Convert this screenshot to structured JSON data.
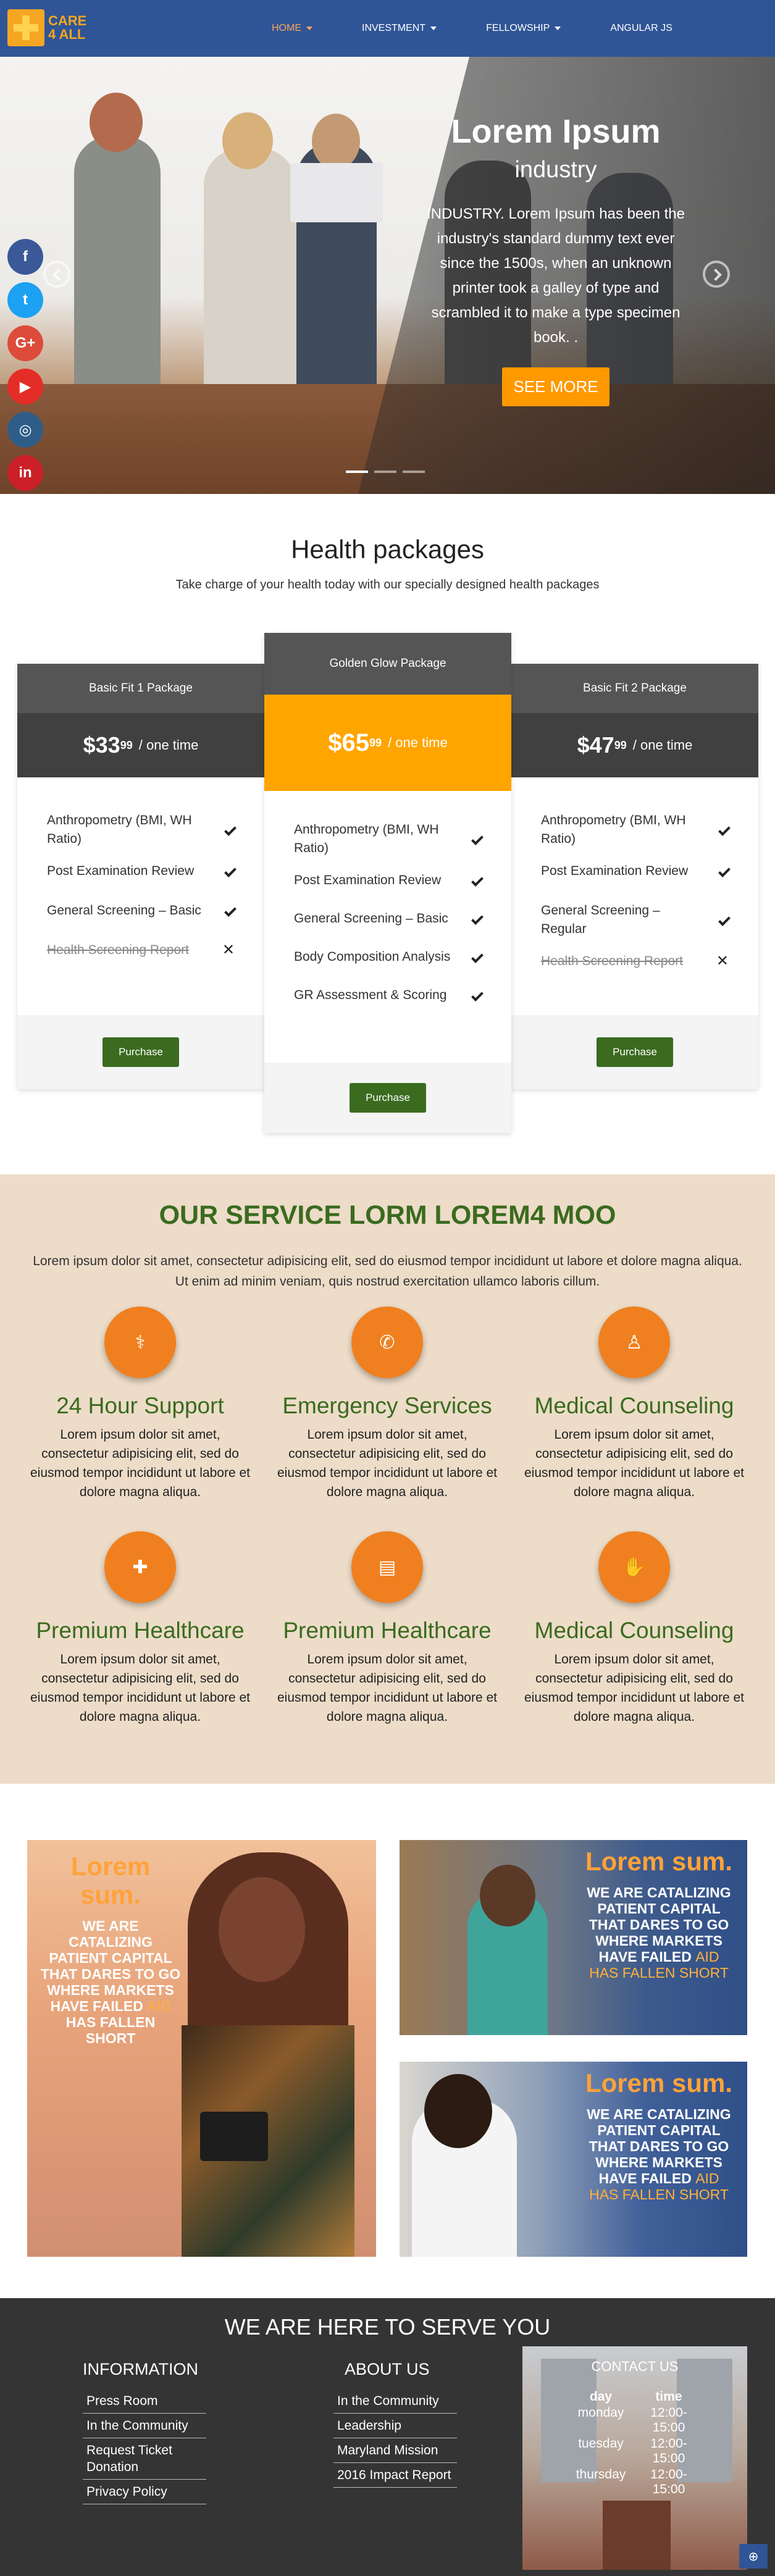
{
  "brand": {
    "line1": "CARE",
    "line2": "4 ALL"
  },
  "nav": [
    {
      "label": "HOME",
      "dropdown": true,
      "active": true
    },
    {
      "label": "INVESTMENT",
      "dropdown": true,
      "active": false
    },
    {
      "label": "FELLOWSHIP",
      "dropdown": true,
      "active": false
    },
    {
      "label": "ANGULAR JS",
      "dropdown": false,
      "active": false
    }
  ],
  "hero": {
    "title": "Lorem Ipsum",
    "subtitle": "industry",
    "text": "INDUSTRY. Lorem Ipsum has been the industry's standard dummy text ever since the 1500s, when an unknown printer took a galley of type and scrambled it to make a type specimen book. .",
    "button": "SEE MORE"
  },
  "social": [
    {
      "name": "facebook-icon",
      "glyph": "f",
      "color": "#3b5998"
    },
    {
      "name": "twitter-icon",
      "glyph": "t",
      "color": "#1da1f2"
    },
    {
      "name": "google-plus-icon",
      "glyph": "G+",
      "color": "#dd4b39"
    },
    {
      "name": "youtube-icon",
      "glyph": "▶",
      "color": "#e52d27"
    },
    {
      "name": "instagram-icon",
      "glyph": "◎",
      "color": "#2e5e88"
    },
    {
      "name": "linkedin-icon",
      "glyph": "in",
      "color": "#cb2027"
    }
  ],
  "packages": {
    "title": "Health packages",
    "subtitle": "Take charge of your health today with our specially designed health packages",
    "cards": [
      {
        "name": "Basic Fit 1 Package",
        "price": "$33",
        "cents": "99",
        "unit": "/ one time",
        "features": [
          {
            "text": "Anthropometry (BMI, WH Ratio)",
            "included": true
          },
          {
            "text": "Post Examination Review",
            "included": true
          },
          {
            "text": "General Screening – Basic",
            "included": true
          },
          {
            "text": "Health Screening Report",
            "included": false
          }
        ],
        "button": "Purchase"
      },
      {
        "name": "Golden Glow Package",
        "price": "$65",
        "cents": "99",
        "unit": "/ one time",
        "features": [
          {
            "text": "Anthropometry (BMI, WH Ratio)",
            "included": true
          },
          {
            "text": "Post Examination Review",
            "included": true
          },
          {
            "text": "General Screening – Basic",
            "included": true
          },
          {
            "text": "Body Composition Analysis",
            "included": true
          },
          {
            "text": "GR Assessment & Scoring",
            "included": true
          }
        ],
        "button": "Purchase"
      },
      {
        "name": "Basic Fit 2 Package",
        "price": "$47",
        "cents": "99",
        "unit": "/ one time",
        "features": [
          {
            "text": "Anthropometry (BMI, WH Ratio)",
            "included": true
          },
          {
            "text": "Post Examination Review",
            "included": true
          },
          {
            "text": "General Screening – Regular",
            "included": true
          },
          {
            "text": "Health Screening Report",
            "included": false
          }
        ],
        "button": "Purchase"
      }
    ],
    "colors": {
      "header": "#555555",
      "featured_header": "#ffa500",
      "price_bg": "#404040",
      "button": "#3a6b1f"
    }
  },
  "services": {
    "title": "OUR SERVICE LORM LOREM4 MOO",
    "intro": "Lorem ipsum dolor sit amet, consectetur adipisicing elit, sed do eiusmod tempor incididunt ut labore et dolore magna aliqua. Ut enim ad minim veniam, quis nostrud exercitation ullamco laboris cillum.",
    "items": [
      {
        "icon": "stethoscope-icon",
        "glyph": "⚕",
        "name": "24 Hour Support",
        "desc": "Lorem ipsum dolor sit amet, consectetur adipisicing elit, sed do eiusmod tempor incididunt ut labore et dolore magna aliqua."
      },
      {
        "icon": "phone-icon",
        "glyph": "✆",
        "name": "Emergency Services",
        "desc": "Lorem ipsum dolor sit amet, consectetur adipisicing elit, sed do eiusmod tempor incididunt ut labore et dolore magna aliqua."
      },
      {
        "icon": "doctor-icon",
        "glyph": "♙",
        "name": "Medical Counseling",
        "desc": "Lorem ipsum dolor sit amet, consectetur adipisicing elit, sed do eiusmod tempor incididunt ut labore et dolore magna aliqua."
      },
      {
        "icon": "medkit-icon",
        "glyph": "✚",
        "name": "Premium Healthcare",
        "desc": "Lorem ipsum dolor sit amet, consectetur adipisicing elit, sed do eiusmod tempor incididunt ut labore et dolore magna aliqua."
      },
      {
        "icon": "book-icon",
        "glyph": "▤",
        "name": "Premium Healthcare",
        "desc": "Lorem ipsum dolor sit amet, consectetur adipisicing elit, sed do eiusmod tempor incididunt ut labore et dolore magna aliqua."
      },
      {
        "icon": "hand-icon",
        "glyph": "✋",
        "name": "Medical Counseling",
        "desc": "Lorem ipsum dolor sit amet, consectetur adipisicing elit, sed do eiusmod tempor incididunt ut labore et dolore magna aliqua."
      }
    ]
  },
  "promos": [
    {
      "lorem": "Lorem sum.",
      "body": "WE ARE CATALIZING PATIENT CAPITAL THAT DARES TO GO WHERE MARKETS HAVE FAILED",
      "aid": "AID",
      "tail": "HAS FALLEN SHORT"
    },
    {
      "lorem": "Lorem sum.",
      "body": "WE ARE CATALIZING PATIENT CAPITAL THAT DARES TO GO WHERE MARKETS HAVE FAILED",
      "aid": "AID",
      "tail": "HAS FALLEN SHORT"
    },
    {
      "lorem": "Lorem sum.",
      "body": "WE ARE CATALIZING PATIENT CAPITAL THAT DARES TO GO WHERE MARKETS HAVE FAILED",
      "aid": "AID",
      "tail": "HAS FALLEN SHORT"
    }
  ],
  "footer": {
    "title": "WE ARE HERE TO SERVE YOU",
    "info_title": "INFORMATION",
    "info_links": [
      "Press Room",
      "In the Community",
      "Request Ticket Donation",
      "Privacy Policy"
    ],
    "about_title": "ABOUT US",
    "about_links": [
      "In the Community",
      "Leadership",
      "Maryland Mission",
      "2016 Impact Report"
    ],
    "contact_title": "CONTACT US",
    "contact_head": [
      "day",
      "time"
    ],
    "contact_rows": [
      [
        "monday",
        "12:00-15:00"
      ],
      [
        "tuesday",
        "12:00-15:00"
      ],
      [
        "thursday",
        "12:00-15:00"
      ]
    ]
  }
}
